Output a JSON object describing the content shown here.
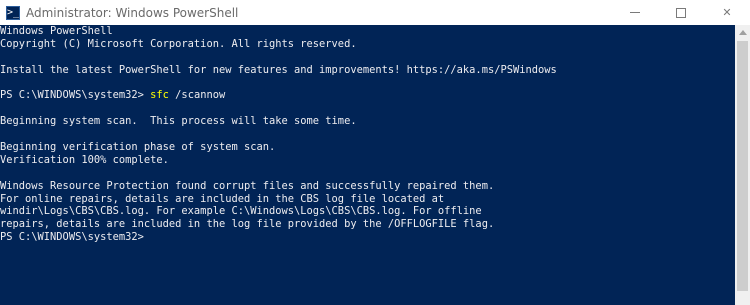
{
  "window": {
    "title": "Administrator: Windows PowerShell",
    "icon": "powershell-icon",
    "icon_glyph": ">_",
    "controls": {
      "minimize": "minimize-icon",
      "maximize": "maximize-icon",
      "close": "close-icon",
      "close_glyph": "✕"
    }
  },
  "colors": {
    "console_bg": "#012456",
    "console_fg": "#eeedf0",
    "command_fg": "#ffff00"
  },
  "console": {
    "lines": [
      {
        "prompt": "",
        "command": "",
        "text": "Windows PowerShell"
      },
      {
        "prompt": "",
        "command": "",
        "text": "Copyright (C) Microsoft Corporation. All rights reserved."
      },
      {
        "prompt": "",
        "command": "",
        "text": ""
      },
      {
        "prompt": "",
        "command": "",
        "text": "Install the latest PowerShell for new features and improvements! https://aka.ms/PSWindows"
      },
      {
        "prompt": "",
        "command": "",
        "text": ""
      },
      {
        "prompt": "PS C:\\WINDOWS\\system32> ",
        "command": "sfc",
        "text": " /scannow"
      },
      {
        "prompt": "",
        "command": "",
        "text": ""
      },
      {
        "prompt": "",
        "command": "",
        "text": "Beginning system scan.  This process will take some time."
      },
      {
        "prompt": "",
        "command": "",
        "text": ""
      },
      {
        "prompt": "",
        "command": "",
        "text": "Beginning verification phase of system scan."
      },
      {
        "prompt": "",
        "command": "",
        "text": "Verification 100% complete."
      },
      {
        "prompt": "",
        "command": "",
        "text": ""
      },
      {
        "prompt": "",
        "command": "",
        "text": "Windows Resource Protection found corrupt files and successfully repaired them."
      },
      {
        "prompt": "",
        "command": "",
        "text": "For online repairs, details are included in the CBS log file located at"
      },
      {
        "prompt": "",
        "command": "",
        "text": "windir\\Logs\\CBS\\CBS.log. For example C:\\Windows\\Logs\\CBS\\CBS.log. For offline"
      },
      {
        "prompt": "",
        "command": "",
        "text": "repairs, details are included in the log file provided by the /OFFLOGFILE flag."
      },
      {
        "prompt": "PS C:\\WINDOWS\\system32> ",
        "command": "",
        "text": ""
      }
    ]
  }
}
